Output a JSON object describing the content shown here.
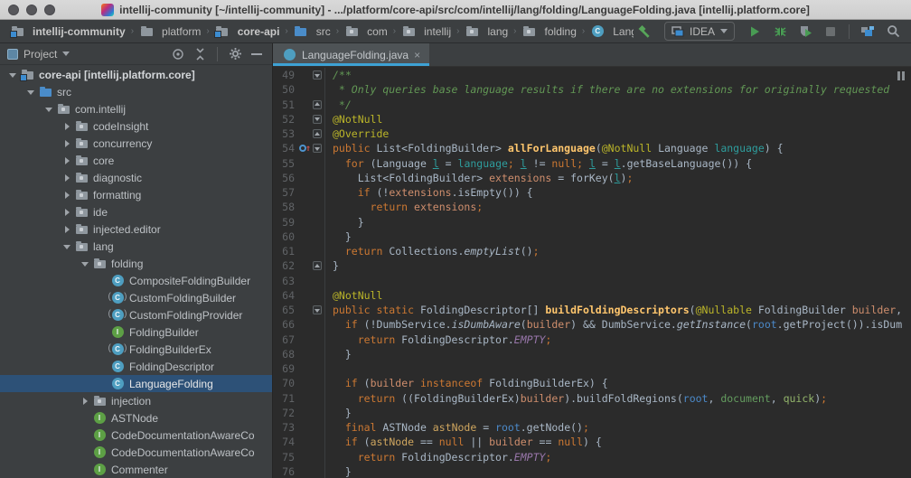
{
  "window": {
    "title": "intellij-community [~/intellij-community] - .../platform/core-api/src/com/intellij/lang/folding/LanguageFolding.java [intellij.platform.core]"
  },
  "glyphs": {
    "chevron": "›",
    "close": "×",
    "up_arrow": "↑"
  },
  "colors": {
    "accent_tab_underline": "#3da1d4",
    "editor_bg": "#2b2b2b",
    "panel_bg": "#3c3f41",
    "tree_selection": "#2d5177",
    "keyword": "#cc7832",
    "annotation": "#bbb529",
    "javadoc_comment": "#629755",
    "method_declaration": "#ffc66d",
    "static_field": "#9876aa",
    "plain_code": "#a9b7c6",
    "line_number": "#606366",
    "run_green": "#499c54",
    "var_teal": "#2e9d9d",
    "var_salmon": "#cf8e6d",
    "var_blue": "#4b89c8",
    "var_green": "#649d5f",
    "var_light_green": "#93b56b",
    "var_tan": "#cfa65f"
  },
  "toolbar": {
    "breadcrumbs": [
      {
        "icon": "module",
        "label": "intellij-community",
        "bold": true
      },
      {
        "icon": "folder",
        "label": "platform",
        "bold": false
      },
      {
        "icon": "module",
        "label": "core-api",
        "bold": true
      },
      {
        "icon": "src",
        "label": "src",
        "bold": false
      },
      {
        "icon": "package",
        "label": "com",
        "bold": false
      },
      {
        "icon": "package",
        "label": "intellij",
        "bold": false
      },
      {
        "icon": "package",
        "label": "lang",
        "bold": false
      },
      {
        "icon": "package",
        "label": "folding",
        "bold": false
      },
      {
        "icon": "class",
        "label": "LanguageFolding",
        "bold": false
      }
    ],
    "run_config": {
      "label": "IDEA"
    }
  },
  "project_panel": {
    "title": "Project",
    "tree": [
      {
        "indent": 0,
        "arrow": "down",
        "icon": "module",
        "label": "core-api [intellij.platform.core]",
        "bold": true
      },
      {
        "indent": 1,
        "arrow": "down",
        "icon": "src",
        "label": "src"
      },
      {
        "indent": 2,
        "arrow": "down",
        "icon": "package",
        "label": "com.intellij"
      },
      {
        "indent": 3,
        "arrow": "right",
        "icon": "package",
        "label": "codeInsight"
      },
      {
        "indent": 3,
        "arrow": "right",
        "icon": "package",
        "label": "concurrency"
      },
      {
        "indent": 3,
        "arrow": "right",
        "icon": "package",
        "label": "core"
      },
      {
        "indent": 3,
        "arrow": "right",
        "icon": "package",
        "label": "diagnostic"
      },
      {
        "indent": 3,
        "arrow": "right",
        "icon": "package",
        "label": "formatting"
      },
      {
        "indent": 3,
        "arrow": "right",
        "icon": "package",
        "label": "ide"
      },
      {
        "indent": 3,
        "arrow": "right",
        "icon": "package",
        "label": "injected.editor"
      },
      {
        "indent": 3,
        "arrow": "down",
        "icon": "package",
        "label": "lang"
      },
      {
        "indent": 4,
        "arrow": "down",
        "icon": "package",
        "label": "folding"
      },
      {
        "indent": 5,
        "arrow": null,
        "icon": "class",
        "label": "CompositeFoldingBuilder"
      },
      {
        "indent": 5,
        "arrow": null,
        "icon": "abstract",
        "label": "CustomFoldingBuilder"
      },
      {
        "indent": 5,
        "arrow": null,
        "icon": "abstract",
        "label": "CustomFoldingProvider"
      },
      {
        "indent": 5,
        "arrow": null,
        "icon": "interface",
        "label": "FoldingBuilder"
      },
      {
        "indent": 5,
        "arrow": null,
        "icon": "abstract",
        "label": "FoldingBuilderEx"
      },
      {
        "indent": 5,
        "arrow": null,
        "icon": "class",
        "label": "FoldingDescriptor"
      },
      {
        "indent": 5,
        "arrow": null,
        "icon": "class",
        "label": "LanguageFolding",
        "selected": true
      },
      {
        "indent": 4,
        "arrow": "right",
        "icon": "package",
        "label": "injection"
      },
      {
        "indent": 4,
        "arrow": null,
        "icon": "interface",
        "label": "ASTNode"
      },
      {
        "indent": 4,
        "arrow": null,
        "icon": "interface",
        "label": "CodeDocumentationAwareCo"
      },
      {
        "indent": 4,
        "arrow": null,
        "icon": "interface",
        "label": "CodeDocumentationAwareCo"
      },
      {
        "indent": 4,
        "arrow": null,
        "icon": "interface",
        "label": "Commenter"
      }
    ]
  },
  "editor": {
    "tab": {
      "label": "LanguageFolding.java"
    },
    "code": {
      "lines": [
        {
          "n": 49,
          "fold": "down",
          "s": [
            [
              "doc",
              "/**"
            ]
          ]
        },
        {
          "n": 50,
          "s": [
            [
              "doc",
              " * Only queries base language results if there are no extensions for originally requested "
            ]
          ]
        },
        {
          "n": 51,
          "fold": "up",
          "s": [
            [
              "doc",
              " */"
            ]
          ]
        },
        {
          "n": 52,
          "fold": "down",
          "s": [
            [
              "ann",
              "@NotNull"
            ]
          ]
        },
        {
          "n": 53,
          "fold": "up",
          "s": [
            [
              "ann",
              "@Override"
            ]
          ]
        },
        {
          "n": 54,
          "fold": "down",
          "ov": true,
          "s": [
            [
              "kw",
              "public "
            ],
            [
              "txt",
              "List<FoldingBuilder> "
            ],
            [
              "mdecl",
              "allForLanguage"
            ],
            [
              "txt",
              "("
            ],
            [
              "ann",
              "@NotNull"
            ],
            [
              "txt",
              " Language "
            ],
            [
              "v1",
              "language"
            ],
            [
              "txt",
              ") {"
            ]
          ]
        },
        {
          "n": 55,
          "s": [
            [
              "txt",
              "  "
            ],
            [
              "kw",
              "for "
            ],
            [
              "txt",
              "(Language "
            ],
            [
              "v1u",
              "l"
            ],
            [
              "txt",
              " = "
            ],
            [
              "v1",
              "language"
            ],
            [
              "semi",
              "; "
            ],
            [
              "v1u",
              "l"
            ],
            [
              "txt",
              " != "
            ],
            [
              "kw",
              "null"
            ],
            [
              "semi",
              "; "
            ],
            [
              "v1u",
              "l"
            ],
            [
              "txt",
              " = "
            ],
            [
              "v1u",
              "l"
            ],
            [
              "txt",
              ".getBaseLanguage()) {"
            ]
          ]
        },
        {
          "n": 56,
          "s": [
            [
              "txt",
              "    List<FoldingBuilder> "
            ],
            [
              "v2",
              "extensions"
            ],
            [
              "txt",
              " = forKey("
            ],
            [
              "v1u",
              "l"
            ],
            [
              "txt",
              ")"
            ],
            [
              "semi",
              ";"
            ]
          ]
        },
        {
          "n": 57,
          "s": [
            [
              "txt",
              "    "
            ],
            [
              "kw",
              "if "
            ],
            [
              "txt",
              "(!"
            ],
            [
              "v2",
              "extensions"
            ],
            [
              "txt",
              ".isEmpty()) {"
            ]
          ]
        },
        {
          "n": 58,
          "s": [
            [
              "txt",
              "      "
            ],
            [
              "kw",
              "return "
            ],
            [
              "v2",
              "extensions"
            ],
            [
              "semi",
              ";"
            ]
          ]
        },
        {
          "n": 59,
          "s": [
            [
              "txt",
              "    }"
            ]
          ]
        },
        {
          "n": 60,
          "s": [
            [
              "txt",
              "  }"
            ]
          ]
        },
        {
          "n": 61,
          "s": [
            [
              "txt",
              "  "
            ],
            [
              "kw",
              "return "
            ],
            [
              "txt",
              "Collections."
            ],
            [
              "smeth",
              "emptyList"
            ],
            [
              "txt",
              "()"
            ],
            [
              "semi",
              ";"
            ]
          ]
        },
        {
          "n": 62,
          "fold": "up",
          "s": [
            [
              "txt",
              "}"
            ]
          ]
        },
        {
          "n": 63,
          "s": []
        },
        {
          "n": 64,
          "s": [
            [
              "ann",
              "@NotNull"
            ]
          ]
        },
        {
          "n": 65,
          "fold": "down",
          "s": [
            [
              "kw",
              "public static "
            ],
            [
              "txt",
              "FoldingDescriptor[] "
            ],
            [
              "mdecl",
              "buildFoldingDescriptors"
            ],
            [
              "txt",
              "("
            ],
            [
              "ann",
              "@Nullable"
            ],
            [
              "txt",
              " FoldingBuilder "
            ],
            [
              "v2",
              "builder"
            ],
            [
              "txt",
              ","
            ]
          ]
        },
        {
          "n": 66,
          "s": [
            [
              "txt",
              "  "
            ],
            [
              "kw",
              "if "
            ],
            [
              "txt",
              "(!DumbService."
            ],
            [
              "smeth",
              "isDumbAware"
            ],
            [
              "txt",
              "("
            ],
            [
              "v2",
              "builder"
            ],
            [
              "txt",
              ") && DumbService."
            ],
            [
              "smeth",
              "getInstance"
            ],
            [
              "txt",
              "("
            ],
            [
              "v3",
              "root"
            ],
            [
              "txt",
              ".getProject()).isDum"
            ]
          ]
        },
        {
          "n": 67,
          "s": [
            [
              "txt",
              "    "
            ],
            [
              "kw",
              "return "
            ],
            [
              "txt",
              "FoldingDescriptor."
            ],
            [
              "sfield",
              "EMPTY"
            ],
            [
              "semi",
              ";"
            ]
          ]
        },
        {
          "n": 68,
          "s": [
            [
              "txt",
              "  }"
            ]
          ]
        },
        {
          "n": 69,
          "s": []
        },
        {
          "n": 70,
          "s": [
            [
              "txt",
              "  "
            ],
            [
              "kw",
              "if "
            ],
            [
              "txt",
              "("
            ],
            [
              "v2",
              "builder"
            ],
            [
              "txt",
              " "
            ],
            [
              "kw",
              "instanceof"
            ],
            [
              "txt",
              " FoldingBuilderEx) {"
            ]
          ]
        },
        {
          "n": 71,
          "s": [
            [
              "txt",
              "    "
            ],
            [
              "kw",
              "return "
            ],
            [
              "txt",
              "((FoldingBuilderEx)"
            ],
            [
              "v2",
              "builder"
            ],
            [
              "txt",
              ").buildFoldRegions("
            ],
            [
              "v3",
              "root"
            ],
            [
              "txt",
              ", "
            ],
            [
              "v4",
              "document"
            ],
            [
              "txt",
              ", "
            ],
            [
              "v5",
              "quick"
            ],
            [
              "txt",
              ")"
            ],
            [
              "semi",
              ";"
            ]
          ]
        },
        {
          "n": 72,
          "s": [
            [
              "txt",
              "  }"
            ]
          ]
        },
        {
          "n": 73,
          "s": [
            [
              "txt",
              "  "
            ],
            [
              "kw",
              "final "
            ],
            [
              "txt",
              "ASTNode "
            ],
            [
              "v6",
              "astNode"
            ],
            [
              "txt",
              " = "
            ],
            [
              "v3",
              "root"
            ],
            [
              "txt",
              ".getNode()"
            ],
            [
              "semi",
              ";"
            ]
          ]
        },
        {
          "n": 74,
          "s": [
            [
              "txt",
              "  "
            ],
            [
              "kw",
              "if "
            ],
            [
              "txt",
              "("
            ],
            [
              "v6",
              "astNode"
            ],
            [
              "txt",
              " == "
            ],
            [
              "kw",
              "null"
            ],
            [
              "txt",
              " || "
            ],
            [
              "v2",
              "builder"
            ],
            [
              "txt",
              " == "
            ],
            [
              "kw",
              "null"
            ],
            [
              "txt",
              ") {"
            ]
          ]
        },
        {
          "n": 75,
          "s": [
            [
              "txt",
              "    "
            ],
            [
              "kw",
              "return "
            ],
            [
              "txt",
              "FoldingDescriptor."
            ],
            [
              "sfield",
              "EMPTY"
            ],
            [
              "semi",
              ";"
            ]
          ]
        },
        {
          "n": 76,
          "s": [
            [
              "txt",
              "  }"
            ]
          ]
        }
      ]
    }
  }
}
